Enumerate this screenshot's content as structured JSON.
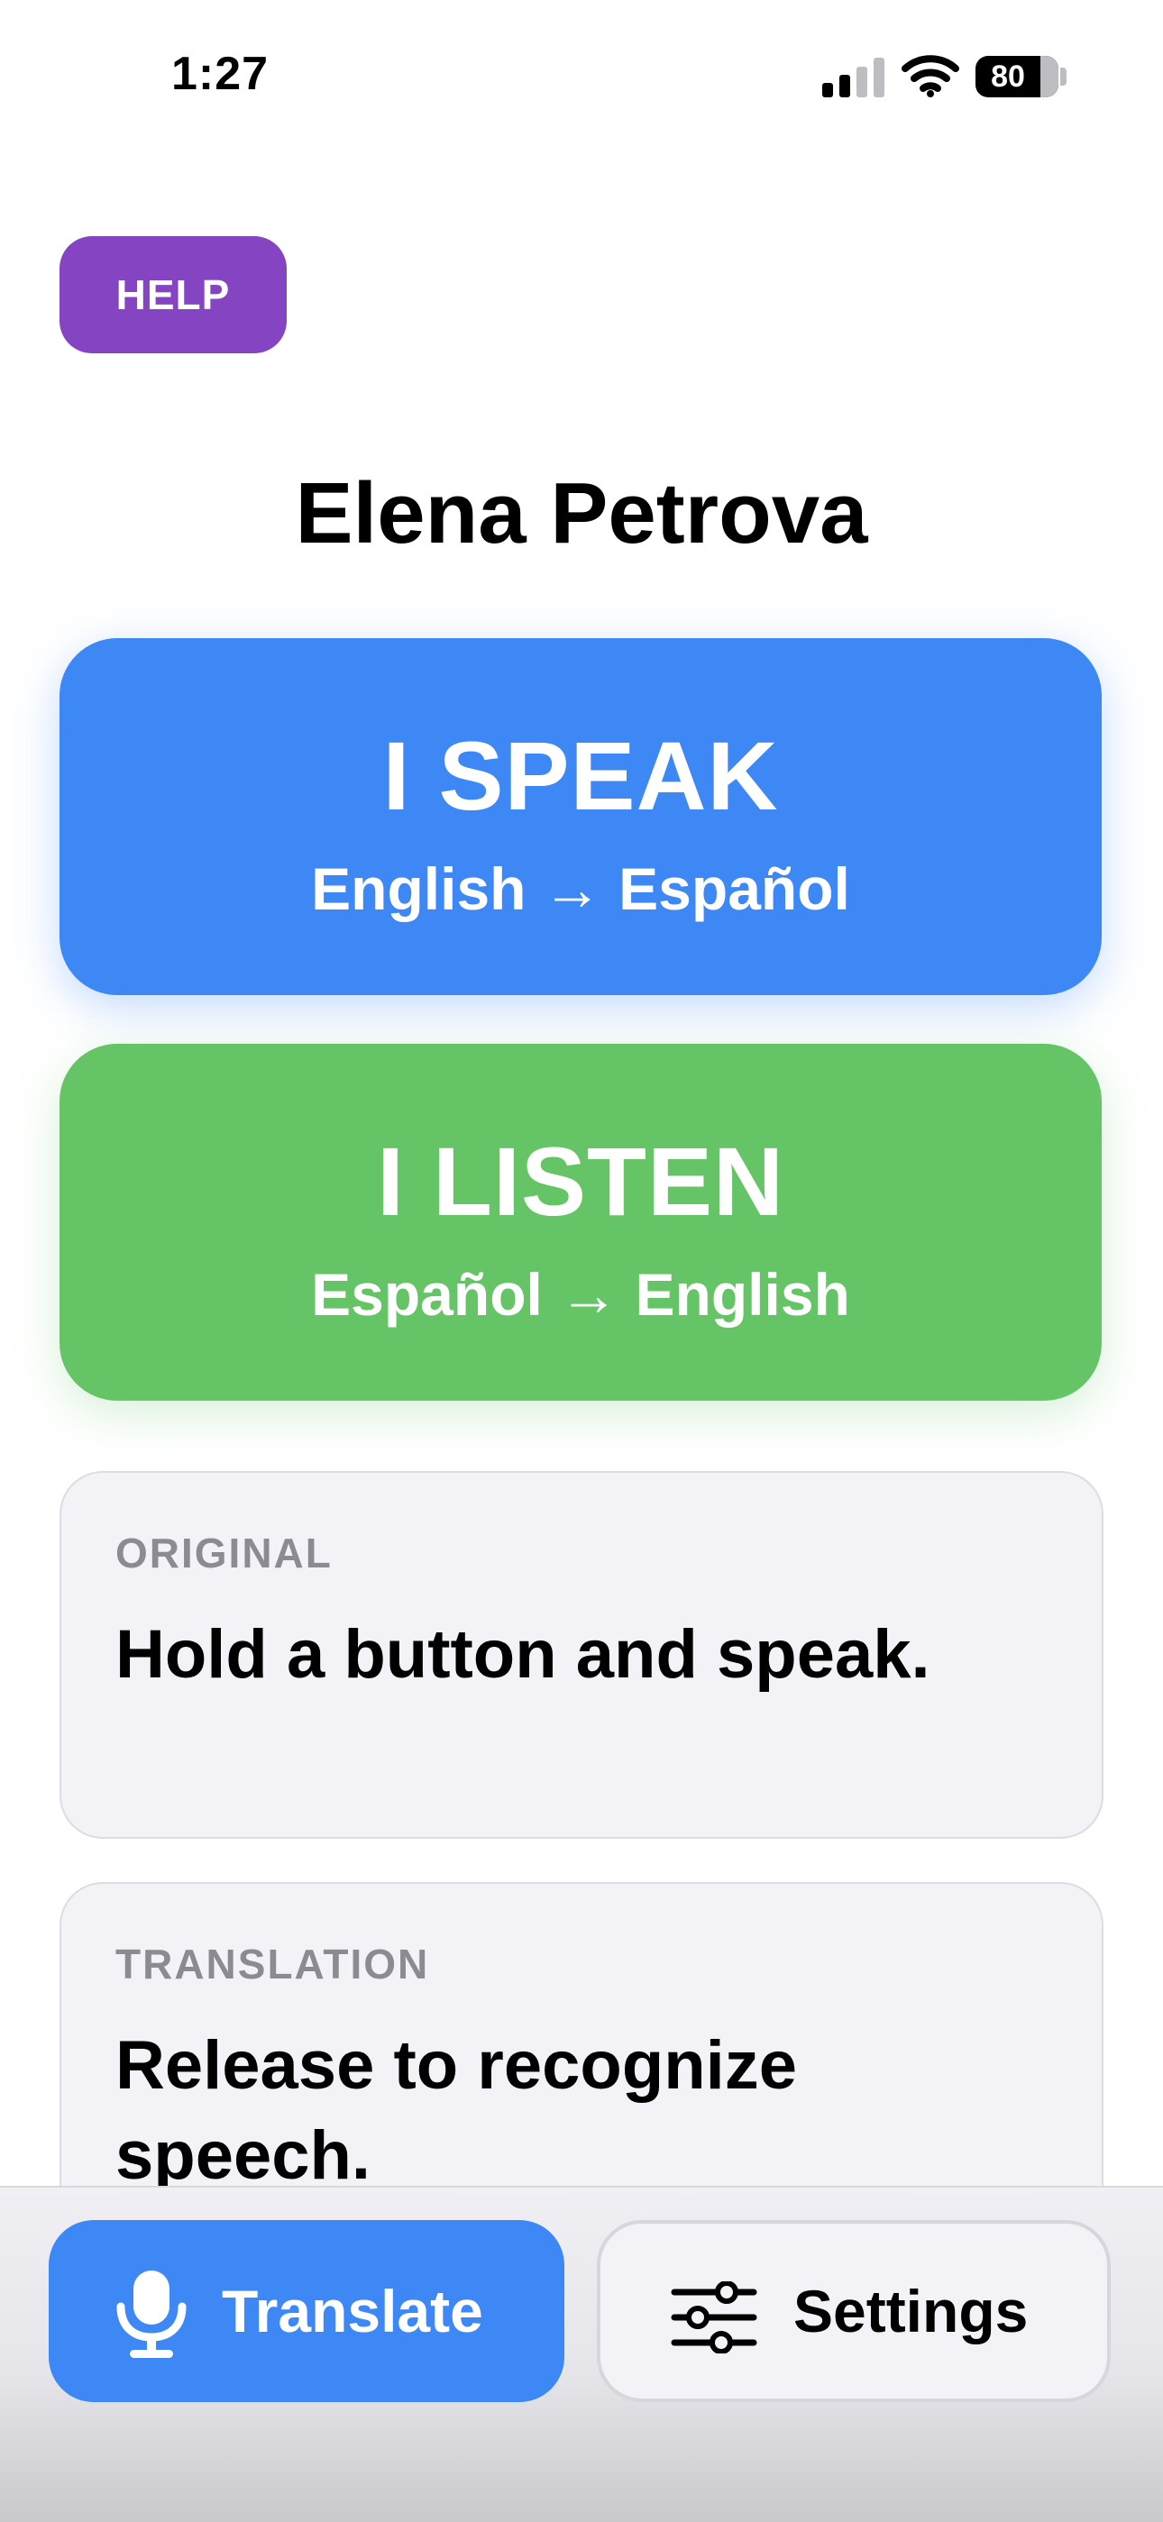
{
  "status_bar": {
    "time": "1:27",
    "battery_level": "80"
  },
  "help": {
    "label": "HELP",
    "color": "#8544c1"
  },
  "user": {
    "name": "Elena Petrova"
  },
  "speak": {
    "label": "I SPEAK",
    "direction": "English → Español",
    "color": "#3d88f5"
  },
  "listen": {
    "label": "I LISTEN",
    "direction": "Español → English",
    "color": "#65c466"
  },
  "original": {
    "label": "ORIGINAL",
    "text": "Hold a button and speak."
  },
  "translation": {
    "label": "TRANSLATION",
    "text": "Release to recognize speech."
  },
  "bottom_bar": {
    "translate_label": "Translate",
    "translate_icon": "microphone-icon",
    "settings_label": "Settings",
    "settings_icon": "sliders-icon"
  }
}
